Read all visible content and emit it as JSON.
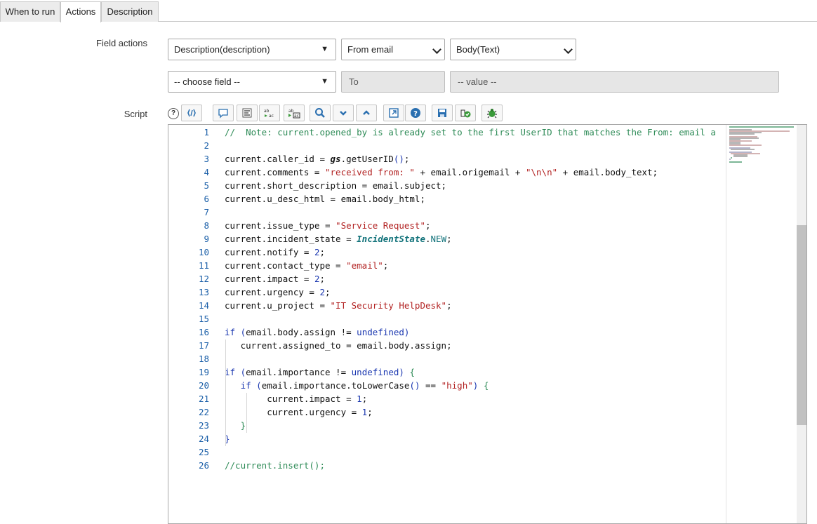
{
  "tabs": [
    {
      "label": "When to run",
      "active": false
    },
    {
      "label": "Actions",
      "active": true
    },
    {
      "label": "Description",
      "active": false
    }
  ],
  "field_actions": {
    "label": "Field actions",
    "row1": {
      "field_select": "Description(description)",
      "source_select": "From email",
      "value_select": "Body(Text)"
    },
    "row2": {
      "field_select": "-- choose field --",
      "to_field": "To",
      "value_field": "-- value --"
    }
  },
  "script": {
    "label": "Script",
    "help_glyph": "?",
    "toolbar_icons": [
      "toggle-syntax-icon",
      "comment-icon",
      "format-icon",
      "replace-icon",
      "replace-all-icon",
      "search-icon",
      "find-next-icon",
      "find-previous-icon",
      "fullscreen-icon",
      "help-icon",
      "save-icon",
      "script-debugger-icon",
      "debug-icon"
    ],
    "line_numbers": [
      "1",
      "2",
      "3",
      "4",
      "5",
      "6",
      "7",
      "8",
      "9",
      "10",
      "11",
      "12",
      "13",
      "14",
      "15",
      "16",
      "17",
      "18",
      "19",
      "20",
      "21",
      "22",
      "23",
      "24",
      "25",
      "26"
    ],
    "lines": [
      [
        {
          "t": "comment",
          "v": "//  Note: current.opened_by is already set to the first UserID that matches the From: email a"
        }
      ],
      [],
      [
        {
          "t": "plain",
          "v": "current.caller_id = "
        },
        {
          "t": "bold",
          "v": "gs"
        },
        {
          "t": "plain",
          "v": ".getUserID"
        },
        {
          "t": "punct",
          "v": "()"
        },
        {
          "t": "plain",
          "v": ";"
        }
      ],
      [
        {
          "t": "plain",
          "v": "current.comments = "
        },
        {
          "t": "string",
          "v": "\"received from: \""
        },
        {
          "t": "plain",
          "v": " + email.origemail + "
        },
        {
          "t": "string",
          "v": "\"\\n\\n\""
        },
        {
          "t": "plain",
          "v": " + email.body_text;"
        }
      ],
      [
        {
          "t": "plain",
          "v": "current.short_description = email.subject;"
        }
      ],
      [
        {
          "t": "plain",
          "v": "current.u_desc_html = email.body_html;"
        }
      ],
      [],
      [
        {
          "t": "plain",
          "v": "current.issue_type = "
        },
        {
          "t": "string",
          "v": "\"Service Request\""
        },
        {
          "t": "plain",
          "v": ";"
        }
      ],
      [
        {
          "t": "plain",
          "v": "current.incident_state = "
        },
        {
          "t": "class",
          "v": "IncidentState"
        },
        {
          "t": "plain",
          "v": "."
        },
        {
          "t": "const",
          "v": "NEW"
        },
        {
          "t": "plain",
          "v": ";"
        }
      ],
      [
        {
          "t": "plain",
          "v": "current.notify = "
        },
        {
          "t": "num",
          "v": "2"
        },
        {
          "t": "plain",
          "v": ";"
        }
      ],
      [
        {
          "t": "plain",
          "v": "current.contact_type = "
        },
        {
          "t": "string",
          "v": "\"email\""
        },
        {
          "t": "plain",
          "v": ";"
        }
      ],
      [
        {
          "t": "plain",
          "v": "current.impact = "
        },
        {
          "t": "num",
          "v": "2"
        },
        {
          "t": "plain",
          "v": ";"
        }
      ],
      [
        {
          "t": "plain",
          "v": "current.urgency = "
        },
        {
          "t": "num",
          "v": "2"
        },
        {
          "t": "plain",
          "v": ";"
        }
      ],
      [
        {
          "t": "plain",
          "v": "current.u_project = "
        },
        {
          "t": "string",
          "v": "\"IT Security HelpDesk\""
        },
        {
          "t": "plain",
          "v": ";"
        }
      ],
      [],
      [
        {
          "t": "keyword",
          "v": "if"
        },
        {
          "t": "plain",
          "v": " "
        },
        {
          "t": "punct",
          "v": "("
        },
        {
          "t": "plain",
          "v": "email.body.assign != "
        },
        {
          "t": "keyword",
          "v": "undefined"
        },
        {
          "t": "punct",
          "v": ")"
        }
      ],
      [
        {
          "t": "plain",
          "v": "   current.assigned_to = email.body.assign;"
        }
      ],
      [],
      [
        {
          "t": "keyword",
          "v": "if"
        },
        {
          "t": "plain",
          "v": " "
        },
        {
          "t": "punct",
          "v": "("
        },
        {
          "t": "plain",
          "v": "email.importance != "
        },
        {
          "t": "keyword",
          "v": "undefined"
        },
        {
          "t": "punct",
          "v": ")"
        },
        {
          "t": "plain",
          "v": " "
        },
        {
          "t": "bracket",
          "v": "{"
        }
      ],
      [
        {
          "t": "plain",
          "v": "   "
        },
        {
          "t": "keyword",
          "v": "if"
        },
        {
          "t": "plain",
          "v": " "
        },
        {
          "t": "punct",
          "v": "("
        },
        {
          "t": "plain",
          "v": "email.importance.toLowerCase"
        },
        {
          "t": "punct",
          "v": "()"
        },
        {
          "t": "plain",
          "v": " == "
        },
        {
          "t": "string",
          "v": "\"high\""
        },
        {
          "t": "punct",
          "v": ")"
        },
        {
          "t": "plain",
          "v": " "
        },
        {
          "t": "bracket",
          "v": "{"
        }
      ],
      [
        {
          "t": "plain",
          "v": "        current.impact = "
        },
        {
          "t": "num",
          "v": "1"
        },
        {
          "t": "plain",
          "v": ";"
        }
      ],
      [
        {
          "t": "plain",
          "v": "        current.urgency = "
        },
        {
          "t": "num",
          "v": "1"
        },
        {
          "t": "plain",
          "v": ";"
        }
      ],
      [
        {
          "t": "plain",
          "v": "   "
        },
        {
          "t": "bracket",
          "v": "}"
        }
      ],
      [
        {
          "t": "punct",
          "v": "}"
        }
      ],
      [],
      [
        {
          "t": "comment",
          "v": "//current.insert();"
        }
      ]
    ]
  }
}
